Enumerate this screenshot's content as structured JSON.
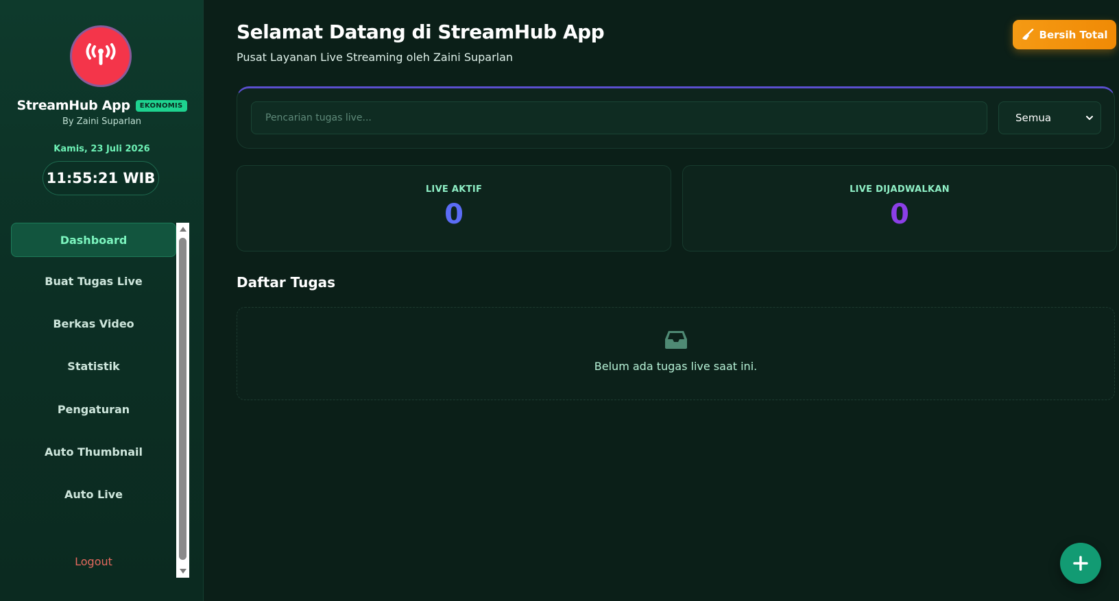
{
  "sidebar": {
    "brand_name": "StreamHub App",
    "badge": "EKONOMIS",
    "by_line": "By Zaini Suparlan",
    "date": "Kamis, 23 Juli 2026",
    "clock": "11:55:21 WIB",
    "logo_icon": "broadcast-tower-icon",
    "nav_items": [
      {
        "label": "Dashboard",
        "active": true
      },
      {
        "label": "Buat Tugas Live"
      },
      {
        "label": "Berkas Video"
      },
      {
        "label": "Statistik"
      },
      {
        "label": "Pengaturan"
      },
      {
        "label": "Auto Thumbnail"
      },
      {
        "label": "Auto Live"
      }
    ],
    "logout": "Logout"
  },
  "header": {
    "title": "Selamat Datang di StreamHub App",
    "subtitle": "Pusat Layanan Live Streaming oleh Zaini Suparlan",
    "clear_button": "Bersih Total",
    "clear_icon": "broom-icon"
  },
  "search": {
    "placeholder": "Pencarian tugas live...",
    "value": "",
    "filter_selected": "Semua"
  },
  "stats": [
    {
      "label": "LIVE AKTIF",
      "value": "0",
      "color": "#5b6cf5"
    },
    {
      "label": "LIVE DIJADWALKAN",
      "value": "0",
      "color": "#8b3fe6"
    }
  ],
  "tasks": {
    "title": "Daftar Tugas",
    "empty_text": "Belum ada tugas live saat ini.",
    "empty_icon": "inbox-icon"
  },
  "fab": {
    "icon": "plus-icon"
  },
  "colors": {
    "accent": "#1ed38f",
    "brand_red": "#f4354a",
    "warning": "#f59a14",
    "logout": "#e66a5e"
  }
}
